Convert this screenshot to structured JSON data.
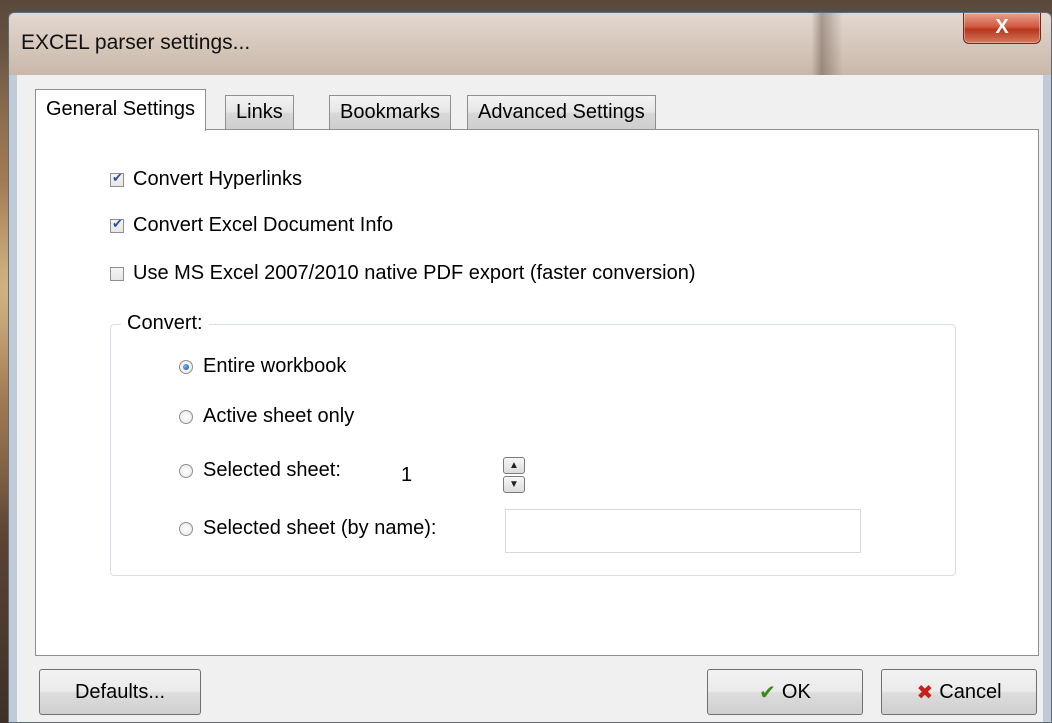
{
  "window": {
    "title": "EXCEL parser settings...",
    "close_glyph": "X"
  },
  "tabs": [
    {
      "label": "General Settings",
      "active": true
    },
    {
      "label": "Links",
      "active": false
    },
    {
      "label": "Bookmarks",
      "active": false
    },
    {
      "label": "Advanced Settings",
      "active": false
    }
  ],
  "options": {
    "convert_hyperlinks": {
      "label": "Convert Hyperlinks",
      "checked": true
    },
    "convert_doc_info": {
      "label": "Convert Excel Document Info",
      "checked": true
    },
    "native_pdf_export": {
      "label": "Use MS Excel 2007/2010 native PDF export (faster conversion)",
      "checked": false
    }
  },
  "convert_group": {
    "legend": "Convert:",
    "entire_workbook": {
      "label": "Entire workbook",
      "selected": true
    },
    "active_sheet": {
      "label": "Active sheet only",
      "selected": false
    },
    "selected_sheet": {
      "label": "Selected sheet:",
      "selected": false,
      "value": "1"
    },
    "selected_sheet_by_name": {
      "label": "Selected sheet (by name):",
      "selected": false,
      "value": ""
    }
  },
  "buttons": {
    "defaults": "Defaults...",
    "ok": "OK",
    "cancel": "Cancel"
  },
  "icons": {
    "ok": "check-icon",
    "cancel": "x-icon",
    "spin_up": "arrow-up-icon",
    "spin_down": "arrow-down-icon"
  }
}
